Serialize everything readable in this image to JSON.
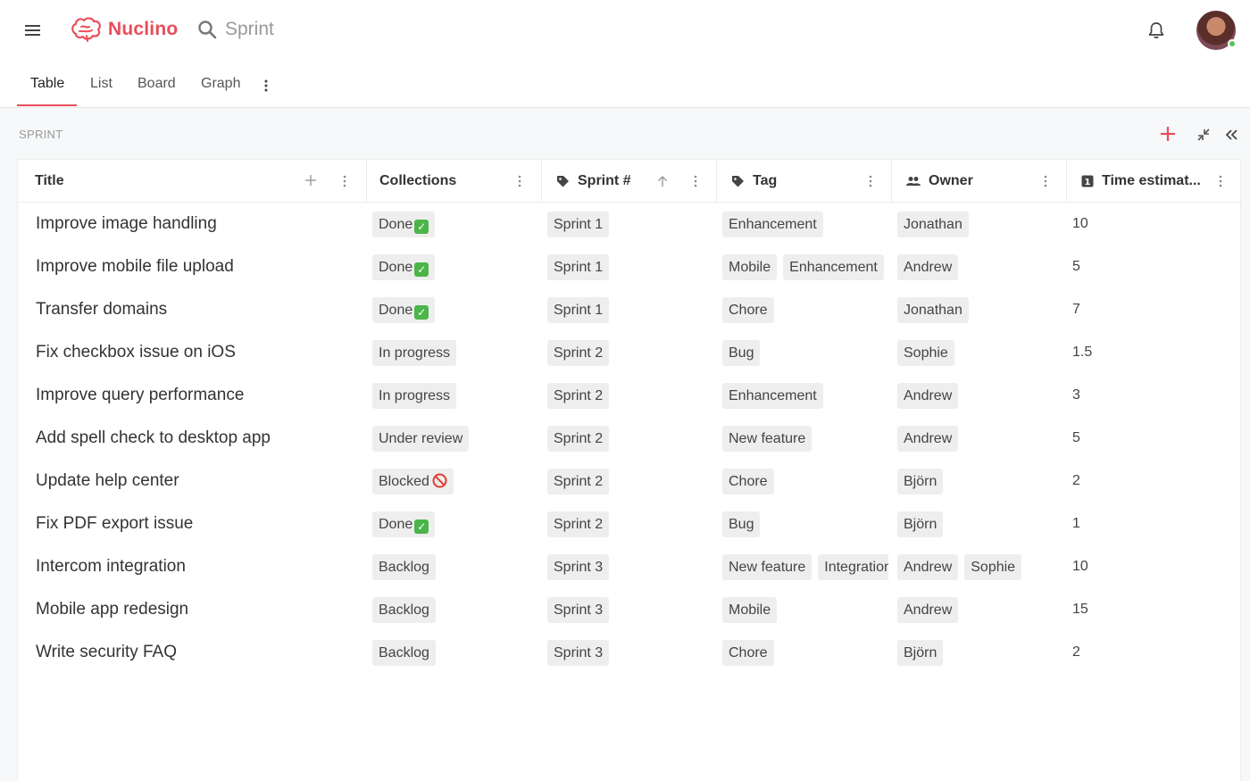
{
  "app": {
    "name": "Nuclino"
  },
  "search": {
    "text": "Sprint"
  },
  "tabs": [
    {
      "label": "Table",
      "active": true
    },
    {
      "label": "List"
    },
    {
      "label": "Board"
    },
    {
      "label": "Graph"
    }
  ],
  "section": {
    "label": "SPRINT"
  },
  "columns": {
    "title": "Title",
    "collections": "Collections",
    "sprint": "Sprint #",
    "tag": "Tag",
    "owner": "Owner",
    "time": "Time estimat..."
  },
  "colors": {
    "accent": "#e94d5a",
    "chip_bg": "#eeeeee",
    "done_check": "#4bb54a",
    "blocked": "#e53935"
  },
  "rows": [
    {
      "title": "Improve image handling",
      "collection": "Done",
      "status_icon": "check-icon",
      "sprint": "Sprint 1",
      "tags": [
        "Enhancement"
      ],
      "owners": [
        "Jonathan"
      ],
      "time": "10"
    },
    {
      "title": "Improve mobile file upload",
      "collection": "Done",
      "status_icon": "check-icon",
      "sprint": "Sprint 1",
      "tags": [
        "Mobile",
        "Enhancement"
      ],
      "owners": [
        "Andrew"
      ],
      "time": "5"
    },
    {
      "title": "Transfer domains",
      "collection": "Done",
      "status_icon": "check-icon",
      "sprint": "Sprint 1",
      "tags": [
        "Chore"
      ],
      "owners": [
        "Jonathan"
      ],
      "time": "7"
    },
    {
      "title": "Fix checkbox issue on iOS",
      "collection": "In progress",
      "status_icon": "",
      "sprint": "Sprint 2",
      "tags": [
        "Bug"
      ],
      "owners": [
        "Sophie"
      ],
      "time": "1.5"
    },
    {
      "title": "Improve query performance",
      "collection": "In progress",
      "status_icon": "",
      "sprint": "Sprint 2",
      "tags": [
        "Enhancement"
      ],
      "owners": [
        "Andrew"
      ],
      "time": "3"
    },
    {
      "title": "Add spell check to desktop app",
      "collection": "Under review",
      "status_icon": "",
      "sprint": "Sprint 2",
      "tags": [
        "New feature"
      ],
      "owners": [
        "Andrew"
      ],
      "time": "5"
    },
    {
      "title": "Update help center",
      "collection": "Blocked",
      "status_icon": "prohibited-icon",
      "sprint": "Sprint 2",
      "tags": [
        "Chore"
      ],
      "owners": [
        "Björn"
      ],
      "time": "2"
    },
    {
      "title": "Fix PDF export issue",
      "collection": "Done",
      "status_icon": "check-icon",
      "sprint": "Sprint 2",
      "tags": [
        "Bug"
      ],
      "owners": [
        "Björn"
      ],
      "time": "1"
    },
    {
      "title": "Intercom integration",
      "collection": "Backlog",
      "status_icon": "",
      "sprint": "Sprint 3",
      "tags": [
        "New feature",
        "Integration"
      ],
      "owners": [
        "Andrew",
        "Sophie"
      ],
      "time": "10"
    },
    {
      "title": "Mobile app redesign",
      "collection": "Backlog",
      "status_icon": "",
      "sprint": "Sprint 3",
      "tags": [
        "Mobile"
      ],
      "owners": [
        "Andrew"
      ],
      "time": "15"
    },
    {
      "title": "Write security FAQ",
      "collection": "Backlog",
      "status_icon": "",
      "sprint": "Sprint 3",
      "tags": [
        "Chore"
      ],
      "owners": [
        "Björn"
      ],
      "time": "2"
    }
  ]
}
